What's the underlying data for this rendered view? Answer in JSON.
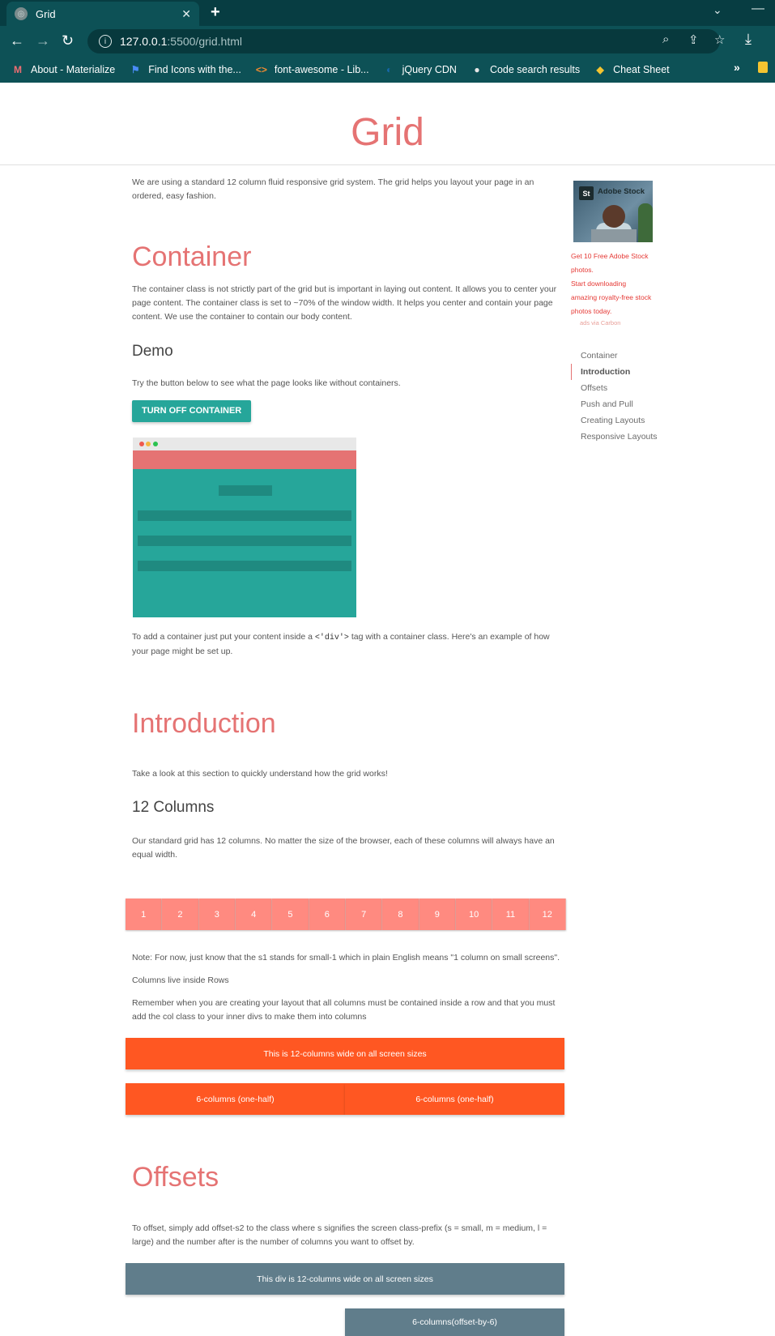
{
  "browser": {
    "tab_title": "Grid",
    "tab_close": "✕",
    "new_tab": "+",
    "url_host": "127.0.0.1",
    "url_path": ":5500/grid.html",
    "bookmarks": [
      {
        "label": "About - Materialize",
        "icon": "M",
        "icon_color": "#ee6e73"
      },
      {
        "label": "Find Icons with the...",
        "icon": "⚑",
        "icon_color": "#4a8cf7"
      },
      {
        "label": "font-awesome - Lib...",
        "icon": "<>",
        "icon_color": "#f28b30"
      },
      {
        "label": "jQuery CDN",
        "icon": "◐",
        "icon_color": "#1769ae"
      },
      {
        "label": "Code search results",
        "icon": "●",
        "icon_color": "#e6e6e6"
      },
      {
        "label": "Cheat Sheet",
        "icon": "◆",
        "icon_color": "#f4c430"
      }
    ],
    "more": "»"
  },
  "page": {
    "title": "Grid",
    "intro": "We are using a standard 12 column fluid responsive grid system. The grid helps you layout your page in an ordered, easy fashion.",
    "container": {
      "heading": "Container",
      "text": "The container class is not strictly part of the grid but is important in laying out content. It allows you to center your page content. The container class is set to ~70% of the window width. It helps you center and contain your page content. We use the container to contain our body content.",
      "demo_heading": "Demo",
      "demo_text": "Try the button below to see what the page looks like without containers.",
      "button": "TURN OFF CONTAINER",
      "after_pre": "To add a container just put your content inside a",
      "after_code": "<'div'>",
      "after_post": "tag with a container class. Here's an example of how your page might be set up."
    },
    "introduction": {
      "heading": "Introduction",
      "text": "Take a look at this section to quickly understand how the grid works!",
      "sub_heading": "12 Columns",
      "sub_text": "Our standard grid has 12 columns. No matter the size of the browser, each of these columns will always have an equal width.",
      "columns": [
        "1",
        "2",
        "3",
        "4",
        "5",
        "6",
        "7",
        "8",
        "9",
        "10",
        "11",
        "12"
      ],
      "note": "Note: For now, just know that the s1 stands for small-1 which in plain English means \"1 column on small screens\".",
      "rows_title": "Columns live inside Rows",
      "rows_text": "Remember when you are creating your layout that all columns must be contained inside a row and that you must add the col class to your inner divs to make them into columns",
      "full": "This is 12-columns wide on all screen sizes",
      "half_left": "6-columns (one-half)",
      "half_right": "6-columns (one-half)"
    },
    "offsets": {
      "heading": "Offsets",
      "text": "To offset, simply add offset-s2 to the class where s signifies the screen class-prefix (s = small, m = medium, l = large) and the number after is the number of columns you want to offset by.",
      "full": "This div is 12-columns wide on all screen sizes",
      "offset": "6-columns(offset-by-6)"
    }
  },
  "sidebar": {
    "ad_brand": "Adobe Stock",
    "ad_logo": "St",
    "ad_line1": "Get 10 Free Adobe Stock",
    "ad_line2": "photos.",
    "ad_line3": "Start downloading",
    "ad_line4": "amazing royalty-free stock",
    "ad_line5": "photos today.",
    "ad_via": "ads via Carbon",
    "toc": [
      "Container",
      "Introduction",
      "Offsets",
      "Push and Pull",
      "Creating Layouts",
      "Responsive Layouts"
    ],
    "toc_active": "Introduction"
  },
  "colors": {
    "accent": "#e57373",
    "teal": "#26a69a",
    "orange": "#ff5722",
    "blue_grey": "#607d8b",
    "salmon": "#ff8a80"
  }
}
